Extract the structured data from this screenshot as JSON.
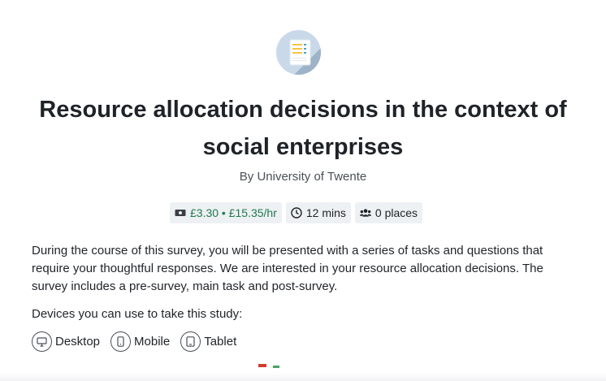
{
  "study": {
    "title": "Resource allocation decisions in the context of social enterprises",
    "byline": "By University of Twente",
    "reward": "£3.30 • £15.35/hr",
    "duration": "12 mins",
    "places": "0 places",
    "description": "During the course of this survey, you will be presented with a series of tasks and questions that require your thoughtful responses. We are interested in your resource allocation decisions. The survey includes a pre-survey, main task and post-survey.",
    "devices_label": "Devices you can use to take this study:",
    "devices": [
      {
        "label": "Desktop",
        "icon": "desktop-icon"
      },
      {
        "label": "Mobile",
        "icon": "mobile-icon"
      },
      {
        "label": "Tablet",
        "icon": "tablet-icon"
      }
    ]
  },
  "colors": {
    "reward_green": "#1f7a4d",
    "pill_bg": "#eef1f4",
    "icon_bg": "#c9d9ea"
  }
}
